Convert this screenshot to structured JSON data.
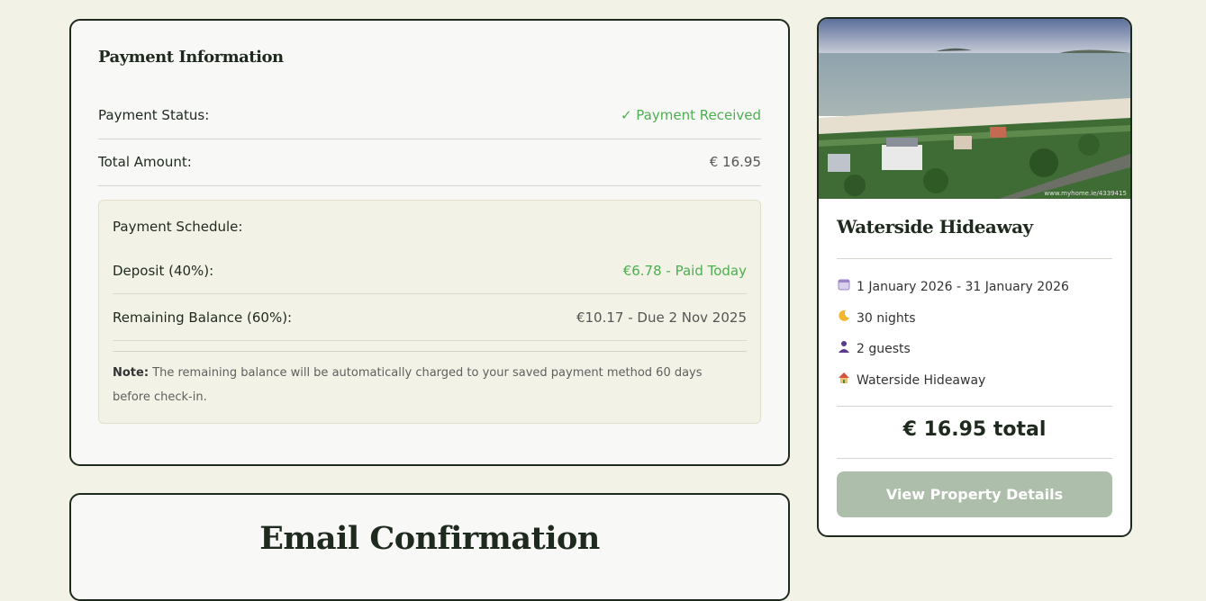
{
  "payment": {
    "title": "Payment Information",
    "status_label": "Payment Status:",
    "status_value": "✓ Payment Received",
    "total_label": "Total Amount:",
    "total_value": "€ 16.95",
    "schedule": {
      "title": "Payment Schedule:",
      "deposit_label": "Deposit (40%):",
      "deposit_value": "€6.78 - Paid Today",
      "balance_label": "Remaining Balance (60%):",
      "balance_value": "€10.17 - Due 2 Nov 2025",
      "note_label": "Note:",
      "note_text": "The remaining balance will be automatically charged to your saved payment method 60 days before check-in."
    }
  },
  "email": {
    "title": "Email Confirmation"
  },
  "summary": {
    "property_name": "Waterside Hideaway",
    "watermark": "www.myhome.ie/4339415",
    "dates": "1 January 2026 - 31 January 2026",
    "nights": "30 nights",
    "guests": "2 guests",
    "location": "Waterside Hideaway",
    "total": "€ 16.95 total",
    "button_label": "View Property Details",
    "icons": [
      "calendar-icon",
      "moon-icon",
      "guest-icon",
      "house-icon"
    ]
  },
  "colors": {
    "accent_green": "#4caf50",
    "button_bg": "#adbfaa",
    "page_bg": "#f3f2e6"
  }
}
